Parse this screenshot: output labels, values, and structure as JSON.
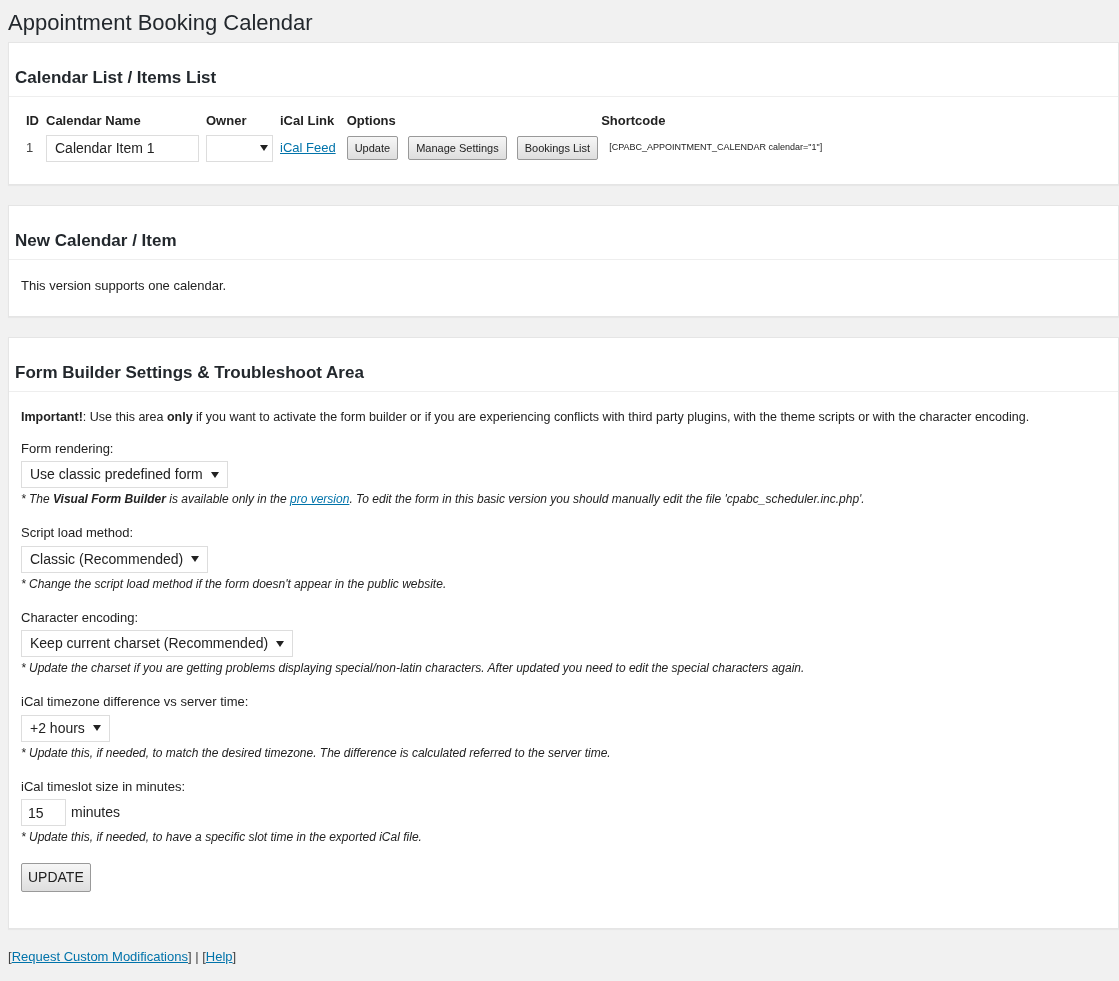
{
  "page_title": "Appointment Booking Calendar",
  "calendar_list": {
    "heading": "Calendar List / Items List",
    "columns": [
      "ID",
      "Calendar Name",
      "Owner",
      "iCal Link",
      "Options",
      "Shortcode"
    ],
    "rows": [
      {
        "id": "1",
        "name": "Calendar Item 1",
        "owner": "",
        "ical_link": "iCal Feed",
        "buttons": [
          "Update",
          "Manage Settings",
          "Bookings List"
        ],
        "shortcode": "[CPABC_APPOINTMENT_CALENDAR calendar=\"1\"]"
      }
    ]
  },
  "new_calendar": {
    "heading": "New Calendar / Item",
    "text": "This version supports one calendar."
  },
  "form_builder": {
    "heading": "Form Builder Settings & Troubleshoot Area",
    "intro": "**Important!**: Use this area **only** if you want to activate the form builder or if you are experiencing conflicts with third party plugins, with the theme scripts or with the character encoding.",
    "settings": [
      {
        "kind": "select",
        "label": "Form rendering:",
        "value": "Use classic predefined form",
        "hint": "* The **Visual Form Builder** is available only in the ",
        "hint_link": "pro version",
        "hint_after": ". To edit the form in this basic version you should manually edit the file 'cpabc_scheduler.inc.php'."
      },
      {
        "kind": "select",
        "label": "Script load method:",
        "value": "Classic (Recommended)",
        "hint": "* Change the script load method if the form doesn't appear in the public website."
      },
      {
        "kind": "select",
        "label": "Character encoding:",
        "value": "Keep current charset (Recommended)",
        "hint": "* Update the charset if you are getting problems displaying special/non-latin characters. After updated you need to edit the special characters again."
      },
      {
        "kind": "select",
        "label": "iCal timezone difference vs server time:",
        "value": "+2 hours",
        "hint": "* Update this, if needed, to match the desired timezone. The difference is calculated referred to the server time."
      },
      {
        "kind": "number",
        "label": "iCal timeslot size in minutes:",
        "value": "15",
        "unit": "minutes",
        "hint": "* Update this, if needed, to have a specific slot time in the exported iCal file."
      }
    ],
    "submit": "UPDATE"
  },
  "footer": [
    {
      "kind": "text",
      "text": "["
    },
    {
      "kind": "link",
      "text": "Request Custom Modifications"
    },
    {
      "kind": "text",
      "text": "] | ["
    },
    {
      "kind": "link",
      "text": "Help"
    },
    {
      "kind": "text",
      "text": "]"
    }
  ]
}
